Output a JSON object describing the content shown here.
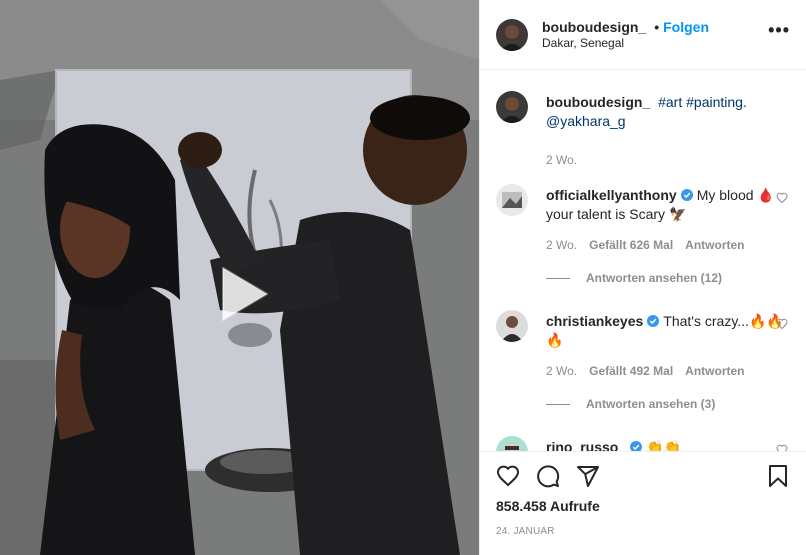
{
  "post": {
    "author": "bouboudesign_",
    "follow_label": "Folgen",
    "separator": "•",
    "location": "Dakar, Senegal",
    "more_label": "•••",
    "caption_user": "bouboudesign_",
    "caption_tags": "#art #painting.",
    "caption_mention": "@yakhara_g",
    "caption_age": "2 Wo."
  },
  "comments": [
    {
      "user": "officialkellyanthony",
      "verified": true,
      "text": "My blood 🩸 your talent is Scary 🦅",
      "age": "2 Wo.",
      "likes": "Gefällt 626 Mal",
      "reply_label": "Antworten",
      "view_replies": "Antworten ansehen (12)"
    },
    {
      "user": "christiankeyes",
      "verified": true,
      "text": "That's crazy...🔥🔥🔥",
      "age": "2 Wo.",
      "likes": "Gefällt 492 Mal",
      "reply_label": "Antworten",
      "view_replies": "Antworten ansehen (3)"
    },
    {
      "user": "rino_russo_",
      "verified": true,
      "text": "👏👏"
    }
  ],
  "footer": {
    "views": "858.458 Aufrufe",
    "date": "24. Januar"
  },
  "icons": {
    "play": "play-icon",
    "like": "heart-icon",
    "comment": "comment-icon",
    "share": "paper-plane-icon",
    "save": "bookmark-icon",
    "verified": "verified-badge-icon"
  },
  "colors": {
    "accent": "#0095f6",
    "verified": "#3897f0",
    "secondary_text": "#8e8e8e"
  }
}
